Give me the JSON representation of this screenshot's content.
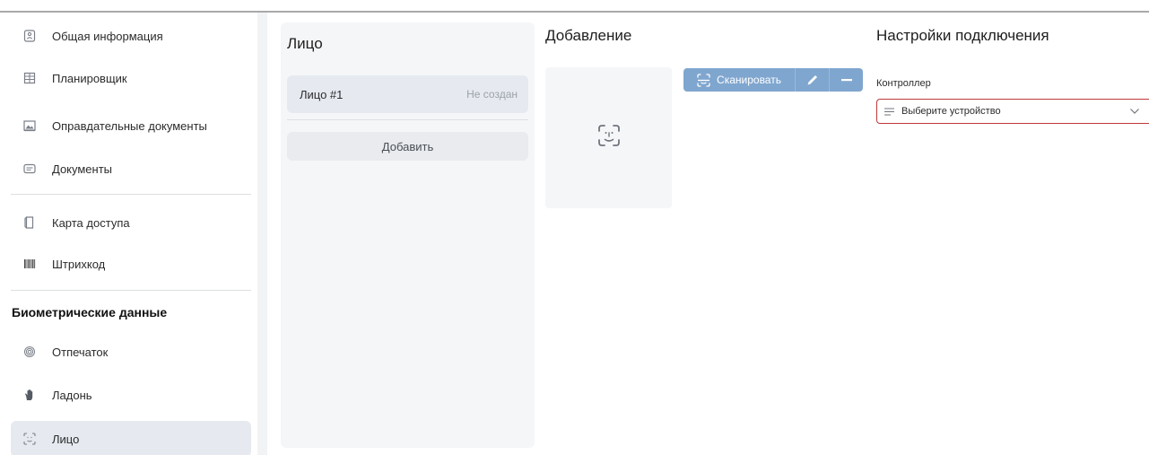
{
  "sidebar": {
    "items": [
      {
        "label": "Общая информация",
        "icon": "person-card-icon"
      },
      {
        "label": "Планировщик",
        "icon": "calendar-icon"
      },
      {
        "label": "Оправдательные документы",
        "icon": "document-image-icon"
      },
      {
        "label": "Документы",
        "icon": "id-card-icon"
      },
      {
        "label": "Карта доступа",
        "icon": "access-card-icon"
      },
      {
        "label": "Штрихкод",
        "icon": "barcode-icon"
      },
      {
        "label": "Отпечаток",
        "icon": "fingerprint-icon"
      },
      {
        "label": "Ладонь",
        "icon": "palm-icon"
      },
      {
        "label": "Лицо",
        "icon": "face-scan-icon"
      }
    ],
    "section_title": "Биометрические данные"
  },
  "faces": {
    "title": "Лицо",
    "item_name": "Лицо #1",
    "item_status": "Не создан",
    "add_label": "Добавить"
  },
  "adding": {
    "title": "Добавление",
    "scan_label": "Сканировать"
  },
  "settings": {
    "title": "Настройки подключения",
    "controller_label": "Контроллер",
    "controller_placeholder": "Выберите устройство"
  },
  "colors": {
    "accent": "#7fa6cf",
    "error_border": "#c0393b",
    "active_bg": "#e6eaf0"
  }
}
